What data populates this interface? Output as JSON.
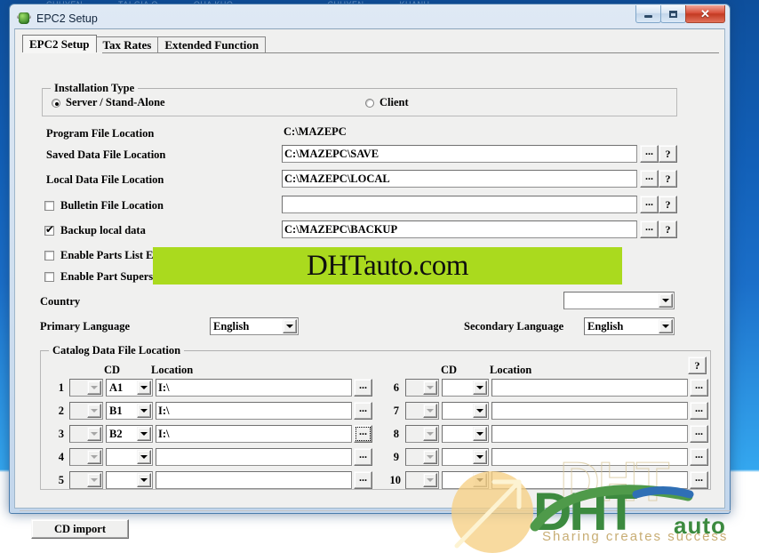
{
  "desktop": {
    "menu_items": [
      "CHUYEN",
      "TAI GIA O",
      "QUA KHO",
      "CHUYEN",
      "KHANH"
    ]
  },
  "window": {
    "title": "EPC2 Setup",
    "icon": "app-globe-icon",
    "buttons": {
      "minimize": "minimize-icon",
      "maximize": "maximize-icon",
      "close": "✕"
    }
  },
  "tabs": [
    {
      "label": "EPC2 Setup",
      "active": true
    },
    {
      "label": "Tax Rates",
      "active": false
    },
    {
      "label": "Extended Function",
      "active": false
    }
  ],
  "installation_type": {
    "title": "Installation Type",
    "options": [
      {
        "label": "Server / Stand-Alone",
        "selected": true
      },
      {
        "label": "Client",
        "selected": false
      }
    ]
  },
  "file_locations": {
    "program": {
      "label": "Program File Location",
      "value": "C:\\MAZEPC",
      "readonly": true
    },
    "saved": {
      "label": "Saved Data File Location",
      "value": "C:\\MAZEPC\\SAVE",
      "browse": "...",
      "help": "?"
    },
    "local": {
      "label": "Local Data File Location",
      "value": "C:\\MAZEPC\\LOCAL",
      "browse": "...",
      "help": "?"
    },
    "bulletin": {
      "label": "Bulletin File Location",
      "value": "",
      "checked": false,
      "browse": "...",
      "help": "?"
    },
    "backup": {
      "label": "Backup local data",
      "value": "C:\\MAZEPC\\BACKUP",
      "checked": true,
      "browse": "...",
      "help": "?"
    }
  },
  "options": [
    {
      "label": "Enable Parts List Export to DMS System",
      "checked": false
    },
    {
      "label": "Enable Part Supersession Search",
      "checked": false
    }
  ],
  "country": {
    "label": "Country",
    "value": ""
  },
  "primary_language": {
    "label": "Primary Language",
    "value": "English"
  },
  "secondary_language": {
    "label": "Secondary Language",
    "value": "English"
  },
  "catalog": {
    "title": "Catalog Data File Location",
    "help": "?",
    "col_cd": "CD",
    "col_location": "Location",
    "rows_left": [
      {
        "num": "1",
        "drive": "",
        "cd": "A1",
        "location": "I:\\",
        "browse": "...",
        "focused": false
      },
      {
        "num": "2",
        "drive": "",
        "cd": "B1",
        "location": "I:\\",
        "browse": "...",
        "focused": false
      },
      {
        "num": "3",
        "drive": "",
        "cd": "B2",
        "location": "I:\\",
        "browse": "...",
        "focused": true
      },
      {
        "num": "4",
        "drive": "",
        "cd": "",
        "location": "",
        "browse": "...",
        "focused": false
      },
      {
        "num": "5",
        "drive": "",
        "cd": "",
        "location": "",
        "browse": "...",
        "focused": false
      }
    ],
    "rows_right": [
      {
        "num": "6",
        "drive": "",
        "cd": "",
        "location": "",
        "browse": "...",
        "focused": false
      },
      {
        "num": "7",
        "drive": "",
        "cd": "",
        "location": "",
        "browse": "...",
        "focused": false
      },
      {
        "num": "8",
        "drive": "",
        "cd": "",
        "location": "",
        "browse": "...",
        "focused": false
      },
      {
        "num": "9",
        "drive": "",
        "cd": "",
        "location": "",
        "browse": "...",
        "focused": false
      },
      {
        "num": "10",
        "drive": "",
        "cd": "",
        "location": "",
        "browse": "...",
        "focused": false
      }
    ]
  },
  "footer": {
    "cd_import": "CD import"
  },
  "watermark": {
    "banner_text": "DHTauto.com",
    "banner_color": "#aada1e",
    "logo_dht": "DHT",
    "logo_auto": "auto",
    "tagline": "Sharing creates success"
  }
}
